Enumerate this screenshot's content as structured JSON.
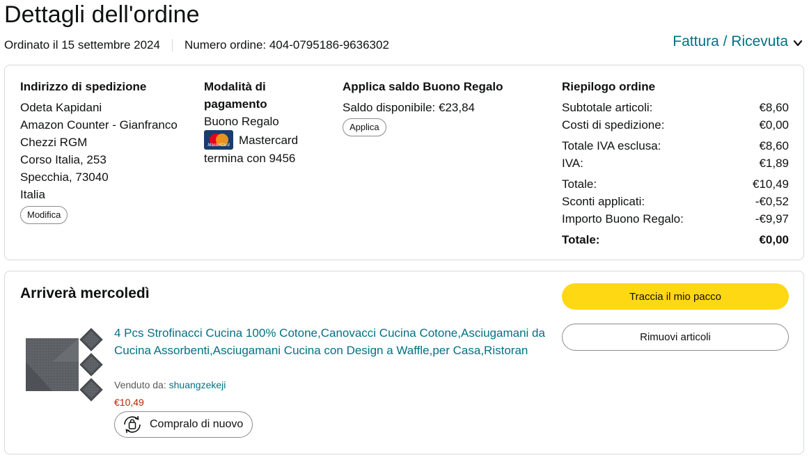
{
  "page": {
    "title": "Dettagli dell'ordine",
    "ordered_on": "Ordinato il 15 settembre 2024",
    "order_number": "Numero ordine: 404-0795186-9636302",
    "invoice_link": "Fattura / Ricevuta"
  },
  "shipping": {
    "heading": "Indirizzo di spedizione",
    "lines": [
      "Odeta Kapidani",
      "Amazon Counter - Gianfranco",
      "Chezzi RGM",
      "Corso Italia, 253",
      "Specchia, 73040",
      "Italia"
    ],
    "edit_button": "Modifica"
  },
  "payment": {
    "heading": "Modalità di pagamento",
    "gift_card": "Buono Regalo",
    "card_brand": "Mastercard",
    "card_logo_text": "MasterCard",
    "card_ending": "termina con 9456"
  },
  "gift_balance": {
    "heading": "Applica saldo Buono Regalo",
    "available": "Saldo disponibile: €23,84",
    "apply_button": "Applica"
  },
  "summary": {
    "heading": "Riepilogo ordine",
    "rows": [
      {
        "label": "Subtotale articoli:",
        "value": "€8,60"
      },
      {
        "label": "Costi di spedizione:",
        "value": "€0,00"
      },
      {
        "label": "Totale IVA esclusa:",
        "value": "€8,60"
      },
      {
        "label": "IVA:",
        "value": "€1,89"
      },
      {
        "label": "Totale:",
        "value": "€10,49"
      },
      {
        "label": "Sconti applicati:",
        "value": "-€0,52"
      },
      {
        "label": "Importo Buono Regalo:",
        "value": "-€9,97"
      },
      {
        "label": "Totale:",
        "value": "€0,00"
      }
    ]
  },
  "shipment": {
    "arrival": "Arriverà mercoledì",
    "track_button": "Traccia il mio pacco",
    "remove_button": "Rimuovi articoli",
    "item": {
      "title": "4 Pcs Strofinacci Cucina 100% Cotone,Canovacci Cucina Cotone,Asciugamani da Cucina Assorbenti,Asciugamani Cucina con Design a Waffle,per Casa,Ristoran",
      "sold_by_label": "Venduto da: ",
      "seller": "shuangzekeji",
      "price": "€10,49",
      "buy_again": "Compralo di nuovo"
    }
  },
  "colors": {
    "link": "#007185",
    "price": "#b12704",
    "track_button": "#ffd814",
    "border": "#d5d9d9"
  }
}
